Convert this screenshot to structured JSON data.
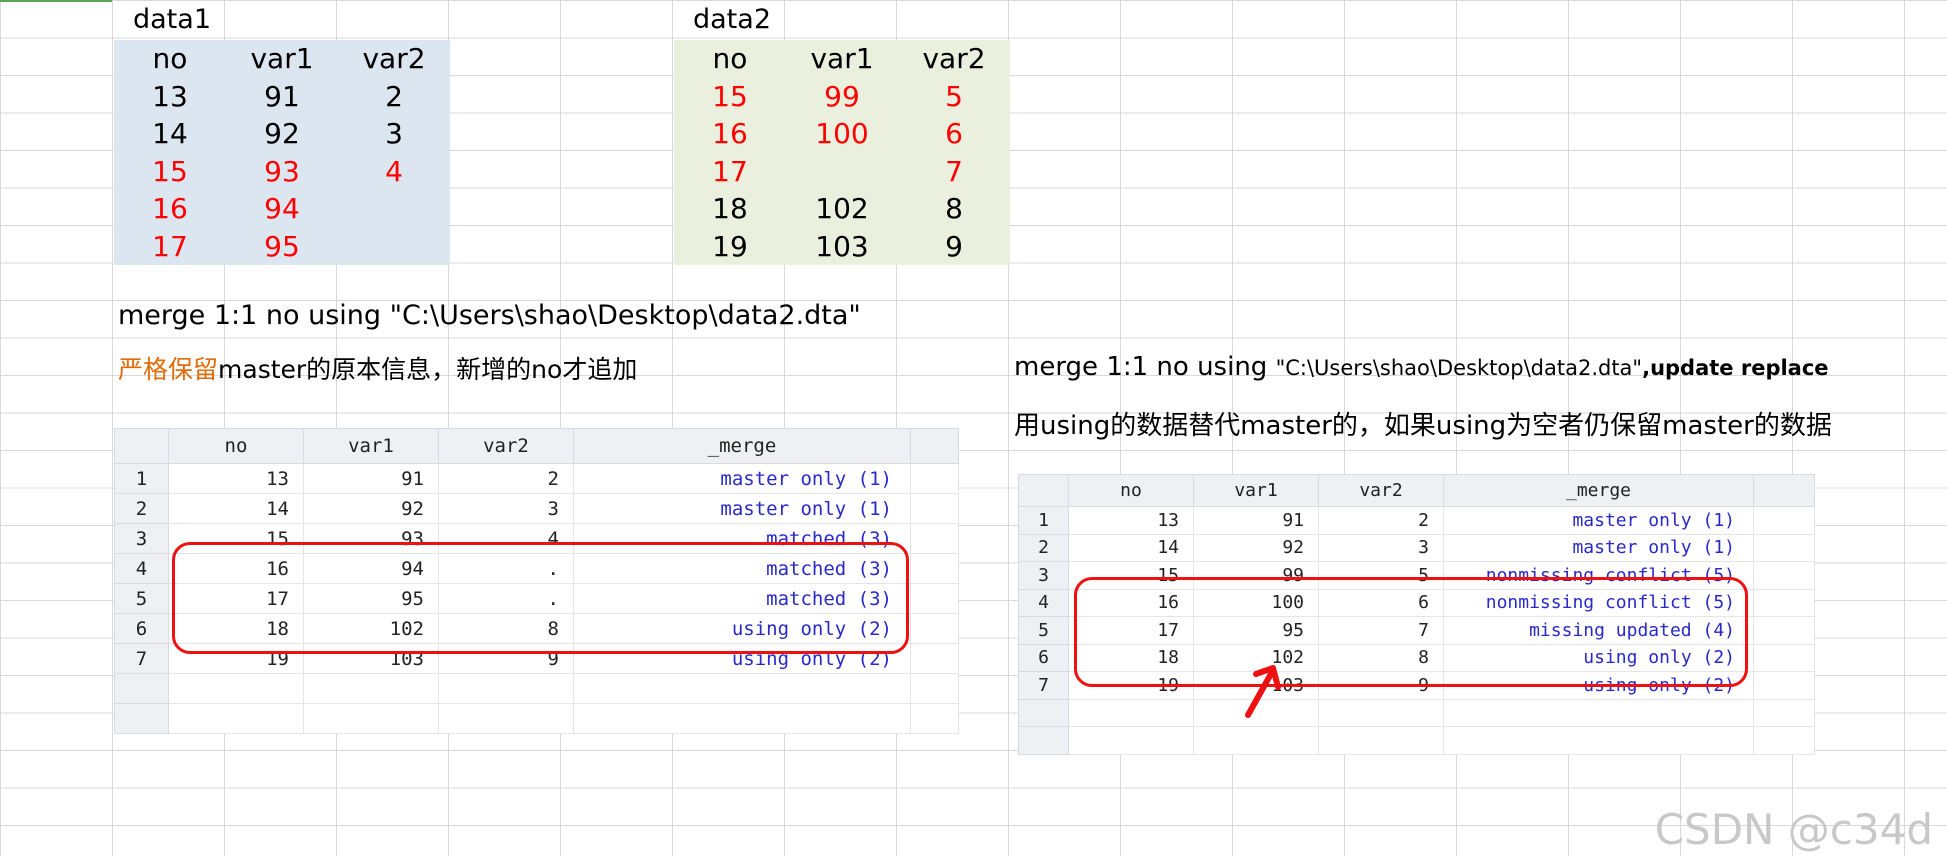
{
  "data1": {
    "title": "data1",
    "headers": [
      "no",
      "var1",
      "var2"
    ],
    "rows": [
      {
        "cells": [
          "13",
          "91",
          "2"
        ],
        "red": false
      },
      {
        "cells": [
          "14",
          "92",
          "3"
        ],
        "red": false
      },
      {
        "cells": [
          "15",
          "93",
          "4"
        ],
        "red": true
      },
      {
        "cells": [
          "16",
          "94",
          ""
        ],
        "red": true
      },
      {
        "cells": [
          "17",
          "95",
          ""
        ],
        "red": true
      }
    ]
  },
  "data2": {
    "title": "data2",
    "headers": [
      "no",
      "var1",
      "var2"
    ],
    "rows": [
      {
        "cells": [
          "15",
          "99",
          "5"
        ],
        "red": true
      },
      {
        "cells": [
          "16",
          "100",
          "6"
        ],
        "red": true
      },
      {
        "cells": [
          "17",
          "",
          "7"
        ],
        "red": true
      },
      {
        "cells": [
          "18",
          "102",
          "8"
        ],
        "red": false
      },
      {
        "cells": [
          "19",
          "103",
          "9"
        ],
        "red": false
      }
    ]
  },
  "left": {
    "command": "merge 1:1 no using \"C:\\Users\\shao\\Desktop\\data2.dta\"",
    "note_orange": "严格保留",
    "note_rest": "master的原本信息，新增的no才追加",
    "grid": {
      "headers": [
        "",
        "no",
        "var1",
        "var2",
        "_merge"
      ],
      "rows": [
        [
          "1",
          "13",
          "91",
          "2",
          "master only (1)"
        ],
        [
          "2",
          "14",
          "92",
          "3",
          "master only (1)"
        ],
        [
          "3",
          "15",
          "93",
          "4",
          "matched (3)"
        ],
        [
          "4",
          "16",
          "94",
          ".",
          "matched (3)"
        ],
        [
          "5",
          "17",
          "95",
          ".",
          "matched (3)"
        ],
        [
          "6",
          "18",
          "102",
          "8",
          "using only (2)"
        ],
        [
          "7",
          "19",
          "103",
          "9",
          "using only (2)"
        ]
      ]
    }
  },
  "right": {
    "command_prefix": "merge 1:1 no using ",
    "command_path": "\"C:\\Users\\shao\\Desktop\\data2.dta\"",
    "command_opts": ",update replace",
    "note": "用using的数据替代master的，如果using为空者仍保留master的数据",
    "grid": {
      "headers": [
        "",
        "no",
        "var1",
        "var2",
        "_merge"
      ],
      "rows": [
        [
          "1",
          "13",
          "91",
          "2",
          "master only (1)"
        ],
        [
          "2",
          "14",
          "92",
          "3",
          "master only (1)"
        ],
        [
          "3",
          "15",
          "99",
          "5",
          "nonmissing conflict (5)"
        ],
        [
          "4",
          "16",
          "100",
          "6",
          "nonmissing conflict (5)"
        ],
        [
          "5",
          "17",
          "95",
          "7",
          "missing updated (4)"
        ],
        [
          "6",
          "18",
          "102",
          "8",
          "using only (2)"
        ],
        [
          "7",
          "19",
          "103",
          "9",
          "using only (2)"
        ]
      ]
    }
  },
  "watermark": "CSDN @c34d",
  "colors": {
    "highlight_red": "#ff0000",
    "merge_text": "#2929c8",
    "orange": "#e26b0a"
  }
}
